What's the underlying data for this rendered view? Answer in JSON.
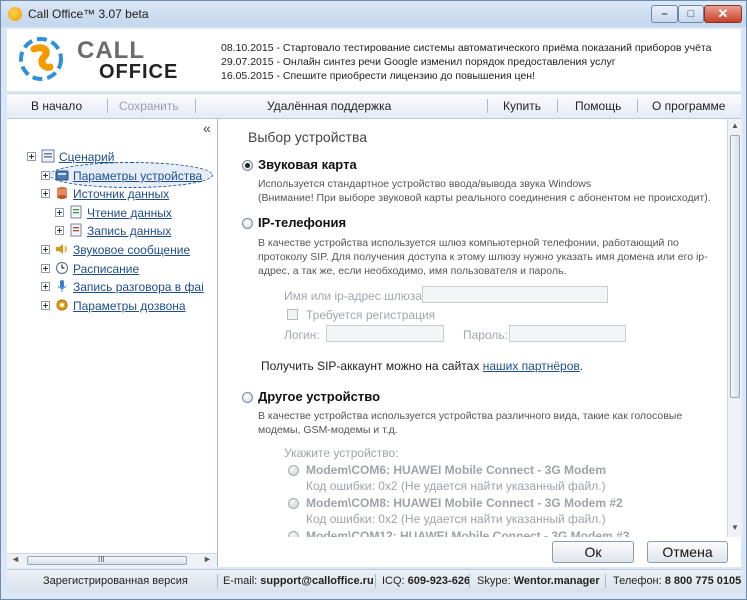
{
  "window": {
    "title": "Call Office™ 3.07 beta",
    "controls": {
      "minimize": "–",
      "maximize": "□",
      "close": "✕"
    }
  },
  "header": {
    "logo_top": "CALL",
    "logo_bottom": "OFFICE",
    "news": [
      "08.10.2015 - Стартовало тестирование системы автоматического приёма показаний приборов учёта",
      "29.07.2015 - Онлайн синтез речи Google изменил порядок предоставления услуг",
      "16.05.2015 - Спешите приобрести лицензию до повышения цен!"
    ]
  },
  "menu": {
    "home": "В начало",
    "save": "Сохранить",
    "remote": "Удалённая поддержка",
    "buy": "Купить",
    "help": "Помощь",
    "about": "О программе"
  },
  "sidebar": {
    "collapse": "«",
    "items": [
      {
        "label": "Сценарий",
        "icon": "scenario-icon"
      },
      {
        "label": "Параметры устройства",
        "icon": "device-icon"
      },
      {
        "label": "Источник данных",
        "icon": "database-icon"
      },
      {
        "label": "Чтение данных",
        "icon": "read-data-icon"
      },
      {
        "label": "Запись данных",
        "icon": "write-data-icon"
      },
      {
        "label": "Звуковое сообщение",
        "icon": "speaker-icon"
      },
      {
        "label": "Расписание",
        "icon": "clock-icon"
      },
      {
        "label": "Запись разговора в фаі",
        "icon": "microphone-icon"
      },
      {
        "label": "Параметры дозвона",
        "icon": "gear-icon"
      }
    ],
    "hscroll_grip": "III"
  },
  "main": {
    "title": "Выбор устройства",
    "sound": {
      "label": "Звуковая карта",
      "desc1": "Используется стандартное устройство ввода/вывода звука Windows",
      "desc2": "(Внимание! При выборе звуковой карты реального соединения с абонентом не происходит)."
    },
    "ip": {
      "label": "IP-телефония",
      "desc1": "В качестве устройства используется шлюз компьютерной телефонии, работающий по",
      "desc2": "протоколу SIP. Для получения доступа к этому шлюзу нужно указать имя домена или его ip-",
      "desc3": "адрес, а так же, если необходимо, имя пользователя и пароль.",
      "gateway_label": "Имя или ip-адрес шлюза:",
      "gateway_value": "",
      "reg_label": "Требуется регистрация",
      "login_label": "Логин:",
      "login_value": "",
      "password_label": "Пароль:",
      "password_value": "",
      "sip_text": "Получить SIP-аккаунт можно на сайтах ",
      "sip_link": "наших партнёров",
      "sip_end": "."
    },
    "other": {
      "label": "Другое устройство",
      "desc1": "В качестве устройства используется устройства различного вида, такие как голосовые",
      "desc2": "модемы, GSM-модемы и т.д.",
      "specify": "Укажите устройство:",
      "devices": [
        {
          "name": "Modem\\COM6: HUAWEI Mobile Connect - 3G Modem",
          "error": "Код ошибки: 0x2 (Не удается найти указанный файл.)"
        },
        {
          "name": "Modem\\COM8: HUAWEI Mobile Connect - 3G Modem #2",
          "error": "Код ошибки: 0x2 (Не удается найти указанный файл.)"
        },
        {
          "name": "Modem\\COM12: HUAWEI Mobile Connect - 3G Modem #3",
          "error": ""
        }
      ]
    },
    "ok": "Ок",
    "cancel": "Отмена"
  },
  "status": {
    "registered": "Зарегистрированная версия",
    "email_label": "E-mail: ",
    "email": "support@calloffice.ru",
    "icq_label": "ICQ: ",
    "icq": "609-923-626",
    "skype_label": "Skype: ",
    "skype": "Wentor.manager",
    "phone_label": "Телефон: ",
    "phone": "8 800 775 0105"
  },
  "colors": {
    "accent": "#1f4d8c",
    "logo_orange": "#f39a00",
    "logo_blue": "#2f8fd8"
  }
}
